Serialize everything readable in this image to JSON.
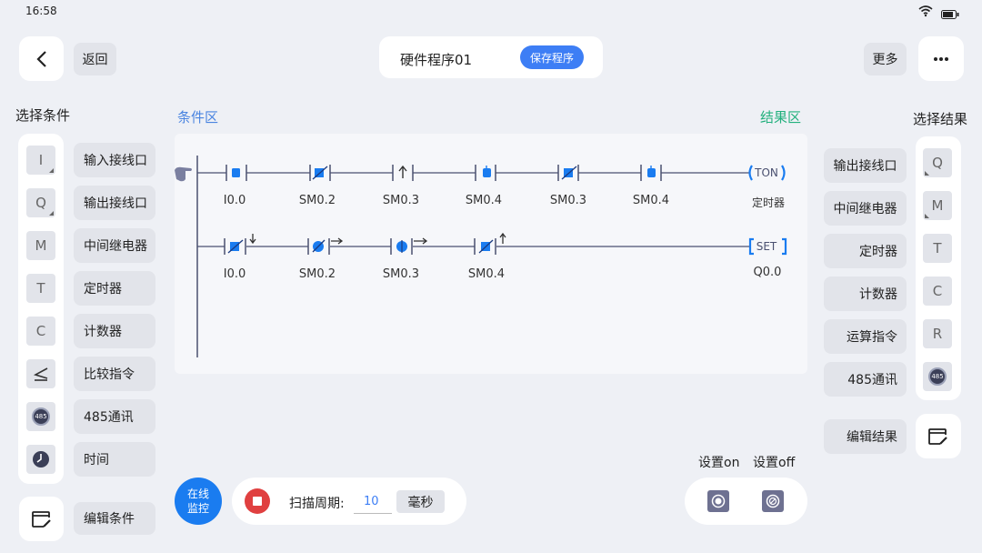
{
  "status": {
    "time": "16:58",
    "wifi_icon": "wifi-icon",
    "battery_icon": "battery-icon"
  },
  "header": {
    "back_label": "返回",
    "program_title": "硬件程序01",
    "save_label": "保存程序",
    "more_label": "更多"
  },
  "left": {
    "title": "选择条件",
    "icons": [
      "I",
      "Q",
      "M",
      "T",
      "C",
      "compare-icon",
      "485-icon",
      "clock-icon"
    ],
    "items": [
      "输入接线口",
      "输出接线口",
      "中间继电器",
      "定时器",
      "计数器",
      "比较指令",
      "485通讯",
      "时间"
    ],
    "edit_label": "编辑条件",
    "badge_text": "485"
  },
  "right": {
    "title": "选择结果",
    "items": [
      "输出接线口",
      "中间继电器",
      "定时器",
      "计数器",
      "运算指令",
      "485通讯"
    ],
    "icons": [
      "Q",
      "M",
      "T",
      "C",
      "R",
      "485-icon"
    ],
    "edit_label": "编辑结果",
    "badge_text": "485"
  },
  "canvas": {
    "condition_label": "条件区",
    "result_label": "结果区",
    "rung1": {
      "contacts": [
        "I0.0",
        "SM0.2",
        "SM0.3",
        "SM0.4",
        "SM0.3",
        "SM0.4"
      ],
      "output_text": "TON",
      "output_label": "定时器"
    },
    "rung2": {
      "contacts": [
        "I0.0",
        "SM0.2",
        "SM0.3",
        "SM0.4"
      ],
      "output_text": "SET",
      "output_label": "Q0.0"
    }
  },
  "footer": {
    "monitor_label_1": "在线",
    "monitor_label_2": "监控",
    "scan_label": "扫描周期:",
    "scan_value": "10",
    "unit_label": "毫秒",
    "set_on_label": "设置on",
    "set_off_label": "设置off"
  },
  "colors": {
    "accent": "#3d7ef5",
    "green": "#22b07d",
    "blue_text": "#4a84e0"
  }
}
